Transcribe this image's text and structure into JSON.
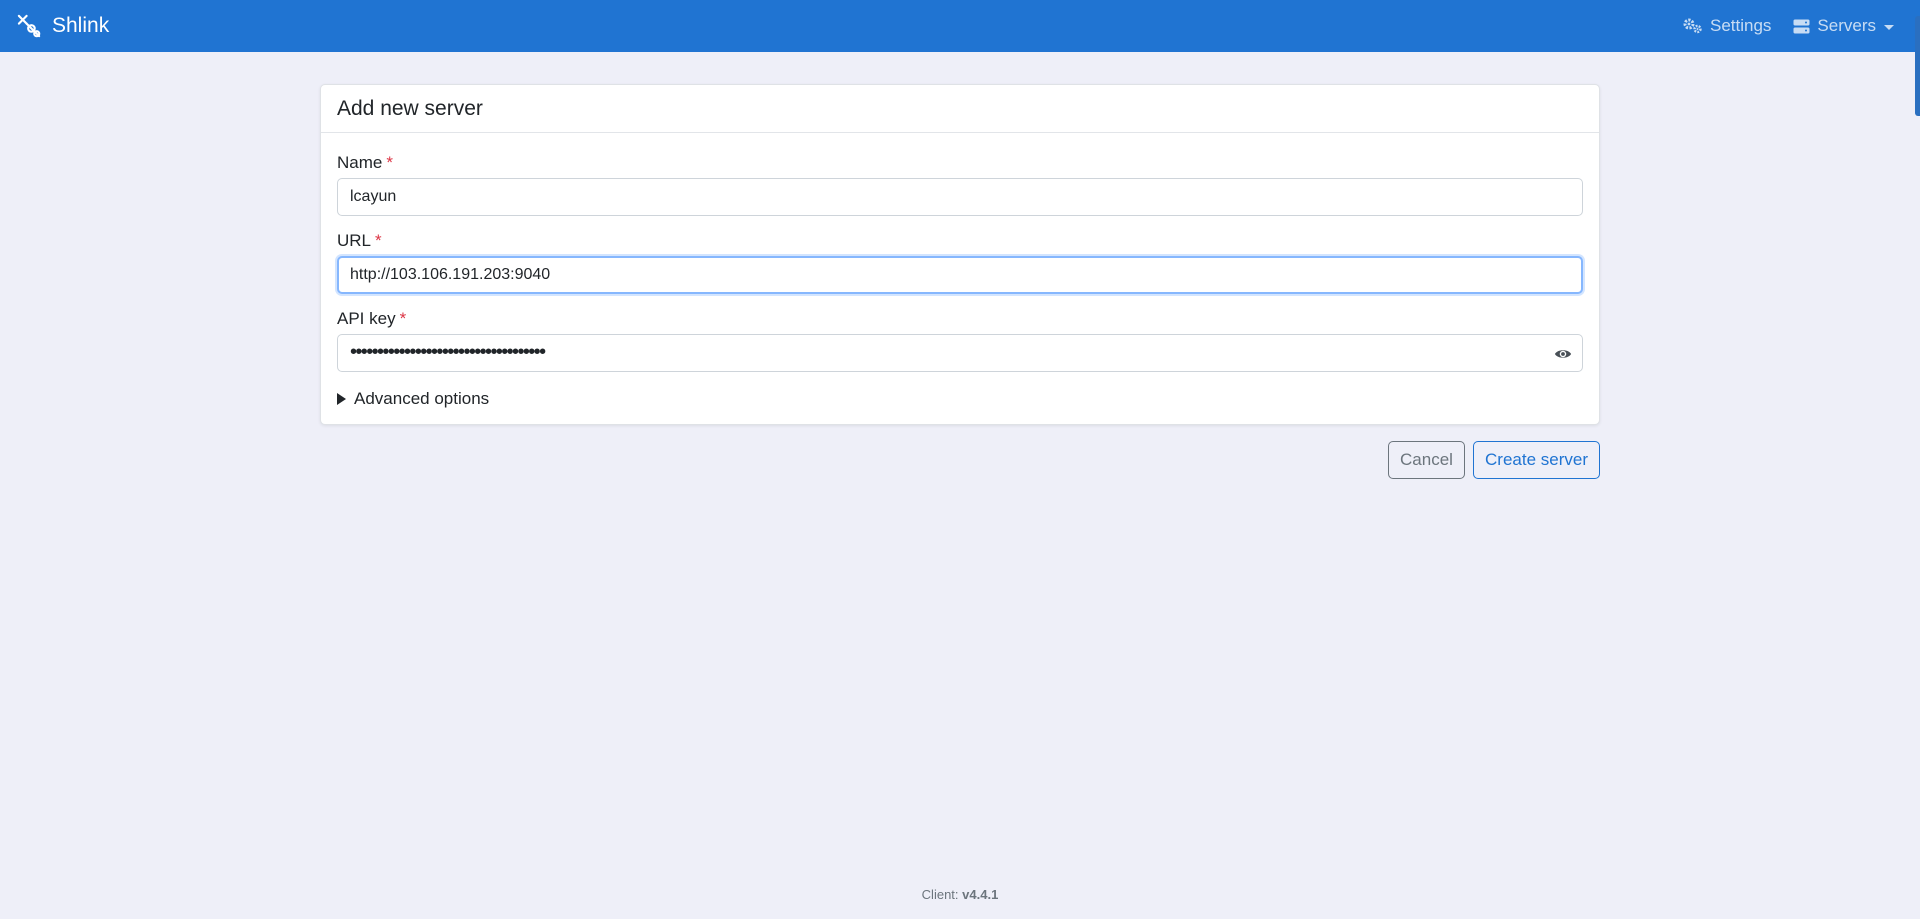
{
  "navbar": {
    "brand": "Shlink",
    "brand_icon": "shlink-logo-icon",
    "settings_label": "Settings",
    "settings_icon": "cogs-icon",
    "servers_label": "Servers",
    "servers_icon": "server-icon",
    "background_color": "#2074d2"
  },
  "form": {
    "title": "Add new server",
    "required_marker": "*",
    "name": {
      "label": "Name",
      "value": "lcayun"
    },
    "url": {
      "label": "URL",
      "value": "http://103.106.191.203:9040"
    },
    "api_key": {
      "label": "API key",
      "masked_value": "••••••••••••••••••••••••••••••••••••",
      "toggle_icon": "eye-icon"
    },
    "advanced_options": "Advanced options"
  },
  "actions": {
    "cancel_label": "Cancel",
    "create_label": "Create server"
  },
  "footer": {
    "client_label": "Client:",
    "version": "v4.4.1"
  }
}
